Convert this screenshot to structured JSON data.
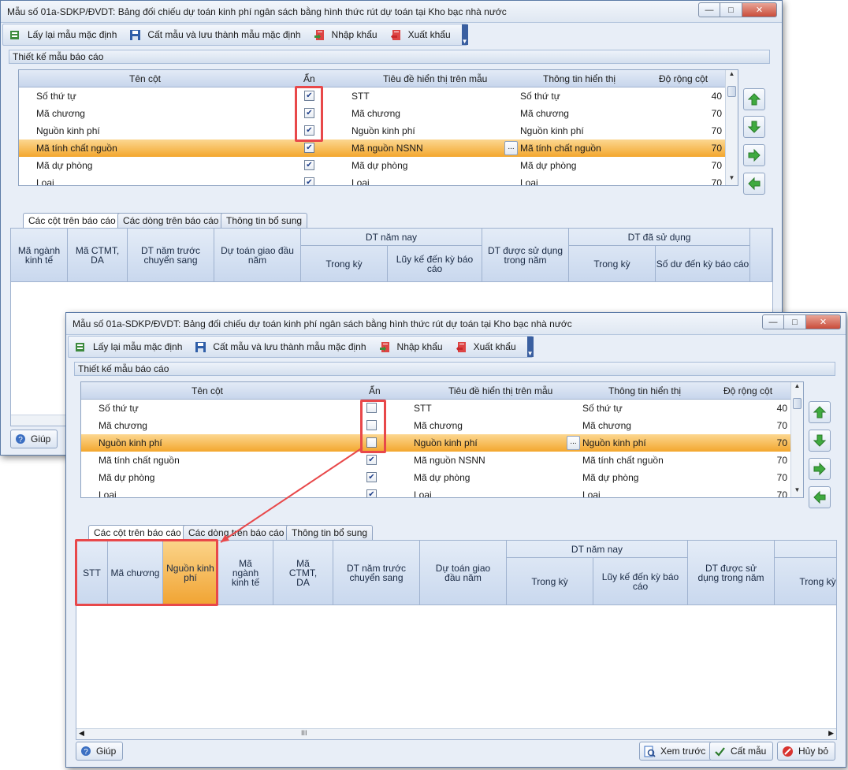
{
  "back_window": {
    "title": "Mẫu số 01a-SDKP/ĐVDT: Bảng đối chiếu dự toán kinh phí ngân sách bằng hình thức rút dự toán tại Kho bạc nhà nước",
    "toolbar": {
      "reset_label": "Lấy lại mẫu mặc định",
      "save_default_label": "Cất mẫu và lưu thành mẫu mặc định",
      "import_label": "Nhập khẩu",
      "export_label": "Xuất khẩu"
    },
    "section_title": "Thiết kế mẫu báo cáo",
    "grid": {
      "headers": {
        "name": "Tên cột",
        "hidden": "Ẩn",
        "caption": "Tiêu đề hiển thị trên mẫu",
        "info": "Thông tin hiển thị",
        "width": "Độ rộng cột"
      },
      "rows": [
        {
          "name": "Số thứ tự",
          "hidden": true,
          "caption": "STT",
          "info": "Số thứ tự",
          "width": "40"
        },
        {
          "name": "Mã chương",
          "hidden": true,
          "caption": "Mã chương",
          "info": "Mã chương",
          "width": "70"
        },
        {
          "name": "Nguồn kinh phí",
          "hidden": true,
          "caption": "Nguồn kinh phí",
          "info": "Nguồn kinh phí",
          "width": "70"
        },
        {
          "name": "Mã tính chất nguồn",
          "hidden": true,
          "caption": "Mã nguồn NSNN",
          "info": "Mã tính chất nguồn",
          "width": "70",
          "selected": true
        },
        {
          "name": "Mã dự phòng",
          "hidden": true,
          "caption": "Mã dự phòng",
          "info": "Mã dự phòng",
          "width": "70"
        },
        {
          "name": "Loại",
          "hidden": true,
          "caption": "Loại",
          "info": "Loại",
          "width": "70"
        }
      ]
    },
    "tabs": [
      "Các cột trên báo cáo",
      "Các dòng trên báo cáo",
      "Thông tin bổ sung"
    ],
    "report_cols": {
      "c1": "Mã ngành kinh tế",
      "c2": "Mã CTMT, DA",
      "c3": "DT năm trước chuyển sang",
      "c4": "Dự toán giao đầu năm",
      "g1": "DT năm nay",
      "g1a": "Trong kỳ",
      "g1b": "Lũy kế đến kỳ báo cáo",
      "c5": "DT được sử dụng trong năm",
      "g2": "DT đã sử dụng",
      "g2a": "Trong kỳ",
      "g2b": "Số dư đến kỳ báo cáo"
    },
    "help_label": "Giúp"
  },
  "front_window": {
    "title": "Mẫu số 01a-SDKP/ĐVDT: Bảng đối chiếu dự toán kinh phí ngân sách bằng hình thức rút dự toán tại Kho bạc nhà nước",
    "toolbar": {
      "reset_label": "Lấy lại mẫu mặc định",
      "save_default_label": "Cất mẫu và lưu thành mẫu mặc định",
      "import_label": "Nhập khẩu",
      "export_label": "Xuất khẩu"
    },
    "section_title": "Thiết kế mẫu báo cáo",
    "grid": {
      "headers": {
        "name": "Tên cột",
        "hidden": "Ẩn",
        "caption": "Tiêu đề hiển thị trên mẫu",
        "info": "Thông tin hiển thị",
        "width": "Độ rộng cột"
      },
      "rows": [
        {
          "name": "Số thứ tự",
          "hidden": false,
          "caption": "STT",
          "info": "Số thứ tự",
          "width": "40"
        },
        {
          "name": "Mã chương",
          "hidden": false,
          "caption": "Mã chương",
          "info": "Mã chương",
          "width": "70"
        },
        {
          "name": "Nguồn kinh phí",
          "hidden": false,
          "caption": "Nguồn kinh phí",
          "info": "Nguồn kinh phí",
          "width": "70",
          "selected": true
        },
        {
          "name": "Mã tính chất nguồn",
          "hidden": true,
          "caption": "Mã nguồn NSNN",
          "info": "Mã tính chất nguồn",
          "width": "70"
        },
        {
          "name": "Mã dự phòng",
          "hidden": true,
          "caption": "Mã dự phòng",
          "info": "Mã dự phòng",
          "width": "70"
        },
        {
          "name": "Loại",
          "hidden": true,
          "caption": "Loại",
          "info": "Loại",
          "width": "70"
        }
      ]
    },
    "tabs": [
      "Các cột trên báo cáo",
      "Các dòng trên báo cáo",
      "Thông tin bổ sung"
    ],
    "report_cols": {
      "stt": "STT",
      "chuong": "Mã chương",
      "nguon": "Nguồn kinh phí",
      "c1": "Mã ngành kinh tế",
      "c2": "Mã CTMT, DA",
      "c3": "DT năm trước chuyển sang",
      "c4": "Dự toán giao đầu năm",
      "g1": "DT năm nay",
      "g1a": "Trong kỳ",
      "g1b": "Lũy kế đến kỳ báo cáo",
      "c5": "DT được sử dụng trong năm",
      "g2a": "Trong kỳ"
    },
    "scroll_grip": "III",
    "help_label": "Giúp",
    "preview_label": "Xem trước",
    "save_label": "Cất mẫu",
    "cancel_label": "Hủy bỏ"
  },
  "colors": {
    "selection": "#f3a72e",
    "highlight_box": "#e8484a",
    "window_bg": "#e8eef7"
  }
}
